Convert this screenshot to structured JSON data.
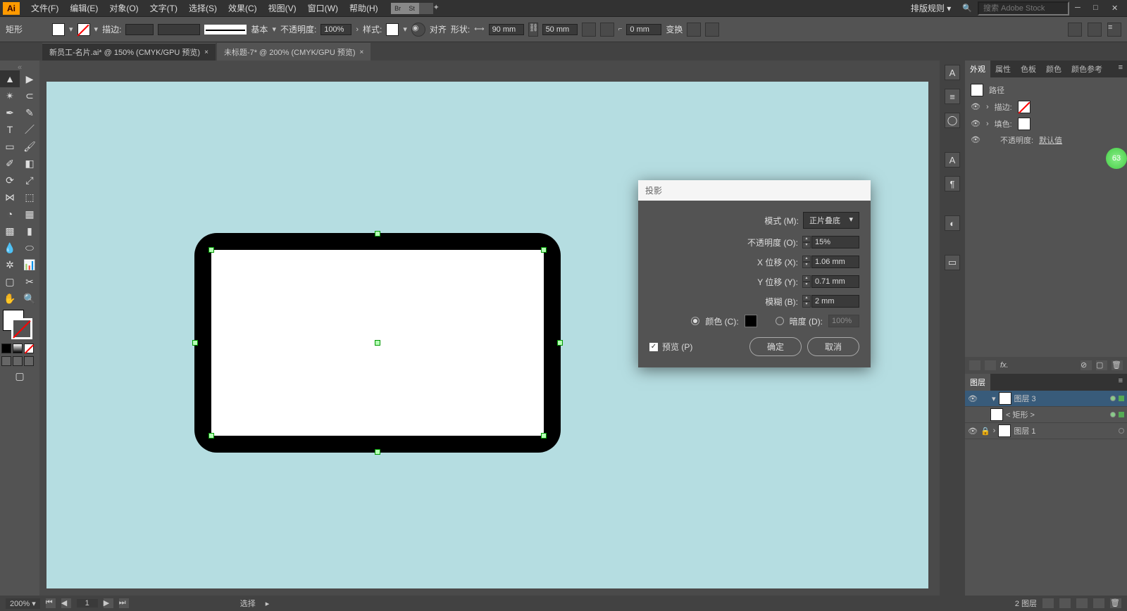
{
  "menu": {
    "items": [
      "文件(F)",
      "编辑(E)",
      "对象(O)",
      "文字(T)",
      "选择(S)",
      "效果(C)",
      "视图(V)",
      "窗口(W)",
      "帮助(H)"
    ],
    "layout_rules": "排版规则",
    "search_placeholder": "搜索 Adobe Stock"
  },
  "control": {
    "shape": "矩形",
    "stroke_label": "描边:",
    "basic": "基本",
    "opacity_label": "不透明度:",
    "opacity_value": "100%",
    "style_label": "样式:",
    "align_label": "对齐",
    "shape_label": "形状:",
    "width_value": "90 mm",
    "height_value": "50 mm",
    "corner_value": "0 mm",
    "transform": "变换"
  },
  "tabs": [
    {
      "label": "新员工-名片.ai* @ 150% (CMYK/GPU 预览)",
      "active": false
    },
    {
      "label": "未标题-7* @ 200% (CMYK/GPU 预览)",
      "active": true
    }
  ],
  "dialog": {
    "title": "投影",
    "mode_label": "模式 (M):",
    "mode_value": "正片叠底",
    "opacity_label": "不透明度 (O):",
    "opacity_value": "15%",
    "x_label": "X 位移 (X):",
    "x_value": "1.06 mm",
    "y_label": "Y 位移 (Y):",
    "y_value": "0.71 mm",
    "blur_label": "模糊 (B):",
    "blur_value": "2 mm",
    "color_label": "颜色 (C):",
    "darkness_label": "暗度 (D):",
    "darkness_value": "100%",
    "preview_label": "预览 (P)",
    "ok": "确定",
    "cancel": "取消"
  },
  "appearance": {
    "tabs": [
      "外观",
      "属性",
      "色板",
      "颜色",
      "颜色参考"
    ],
    "path_label": "路径",
    "stroke_label": "描边:",
    "fill_label": "填色:",
    "opacity_label": "不透明度:",
    "opacity_value": "默认值"
  },
  "layers": {
    "tab": "图层",
    "items": [
      {
        "name": "图层 3",
        "expanded": true,
        "selected": true
      },
      {
        "name": "< 矩形 >",
        "child": true
      },
      {
        "name": "图层 1"
      }
    ],
    "footer": "2 图层"
  },
  "status": {
    "zoom": "200%",
    "mode": "选择"
  },
  "badge": "63"
}
